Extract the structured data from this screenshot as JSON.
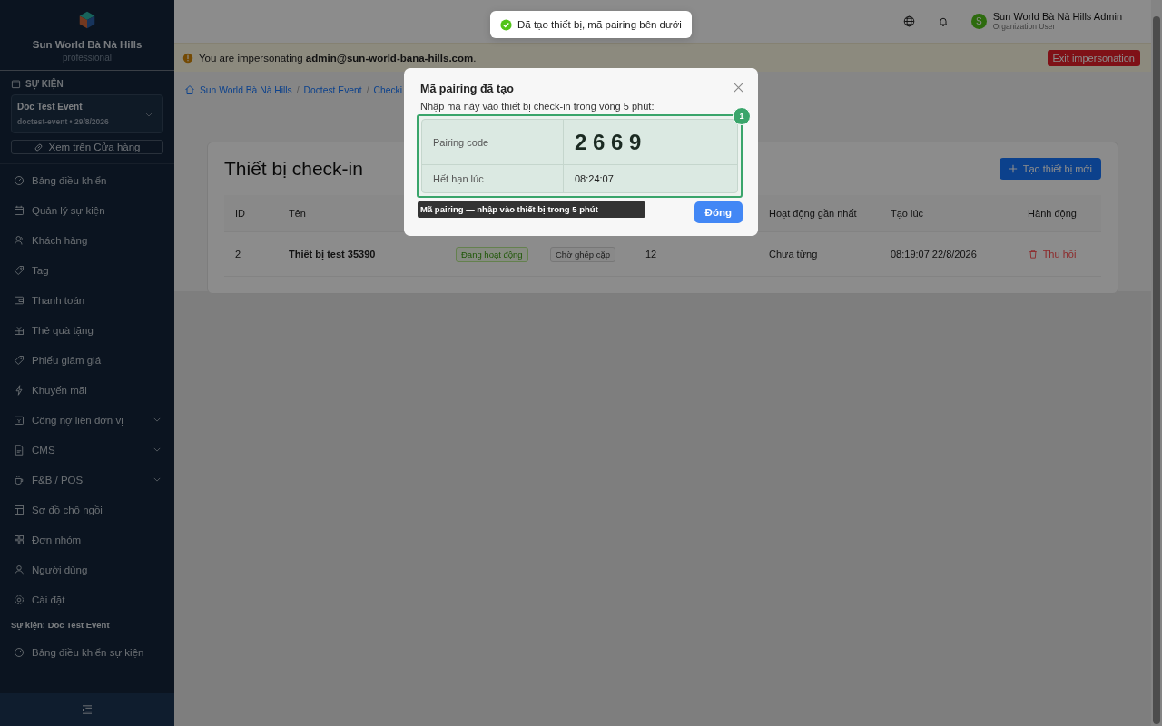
{
  "sidebar": {
    "org_name": "Sun World Bà Nà Hills",
    "plan": "professional",
    "event_section_label": "SỰ KIỆN",
    "event_picker": {
      "name": "Doc Test Event",
      "subtitle": "doctest-event • 29/8/2026"
    },
    "store_link": "Xem trên Cửa hàng",
    "items": [
      {
        "label": "Bảng điều khiển",
        "expandable": false
      },
      {
        "label": "Quản lý sự kiện",
        "expandable": false
      },
      {
        "label": "Khách hàng",
        "expandable": false
      },
      {
        "label": "Tag",
        "expandable": false
      },
      {
        "label": "Thanh toán",
        "expandable": false
      },
      {
        "label": "Thẻ quà tặng",
        "expandable": false
      },
      {
        "label": "Phiếu giảm giá",
        "expandable": false
      },
      {
        "label": "Khuyến mãi",
        "expandable": false
      },
      {
        "label": "Công nợ liên đơn vị",
        "expandable": true
      },
      {
        "label": "CMS",
        "expandable": true
      },
      {
        "label": "F&B / POS",
        "expandable": true
      },
      {
        "label": "Sơ đồ chỗ ngồi",
        "expandable": false
      },
      {
        "label": "Đơn nhóm",
        "expandable": false
      },
      {
        "label": "Người dùng",
        "expandable": false
      },
      {
        "label": "Cài đặt",
        "expandable": false
      }
    ],
    "event_group_title": "Sự kiện: Doc Test Event",
    "event_items": [
      {
        "label": "Bảng điều khiển sự kiện",
        "expandable": false
      }
    ]
  },
  "header": {
    "user_initial": "S",
    "user_name": "Sun World Bà Nà Hills Admin",
    "user_role": "Organization User"
  },
  "impersonation": {
    "text": "You are impersonating **admin@sun-world-bana-hills.com**.",
    "exit_button": "Exit impersonation"
  },
  "breadcrumb": [
    {
      "kind": "link",
      "text": "Sun World Bà Nà Hills"
    },
    {
      "kind": "separator",
      "text": "/"
    },
    {
      "kind": "link",
      "text": "Doctest Event"
    },
    {
      "kind": "separator",
      "text": "/"
    },
    {
      "kind": "link",
      "text": "Checki"
    }
  ],
  "page": {
    "title": "Thiết bị check-in",
    "create_button": "Tạo thiết bị mới"
  },
  "table": {
    "headers": {
      "id": "ID",
      "name": "Tên",
      "last_active": "Hoạt động gần nhất",
      "created": "Tạo lúc",
      "actions": "Hành động"
    },
    "rows": [
      {
        "id": "2",
        "name": "Thiết bị test 35390",
        "status": "Đang hoạt động",
        "pairing_status": "Chờ ghép cặp",
        "column_5": "12",
        "last_active": "Chưa từng",
        "created": "08:19:07 22/8/2026",
        "action": "Thu hồi"
      }
    ]
  },
  "toast": {
    "text": "Đã tạo thiết bị, mã pairing bên dưới"
  },
  "modal": {
    "title": "Mã pairing đã tạo",
    "description": "Nhập mã này vào thiết bị check-in trong vòng 5 phút:",
    "code_label": "Pairing code",
    "code": "2 6 6 9",
    "expires_label": "Hết hạn lúc",
    "expires": "08:24:07",
    "close_button": "Đóng"
  },
  "annotation": {
    "number": "1",
    "caption": "Mã pairing — nhập vào thiết bị trong 5 phút"
  }
}
